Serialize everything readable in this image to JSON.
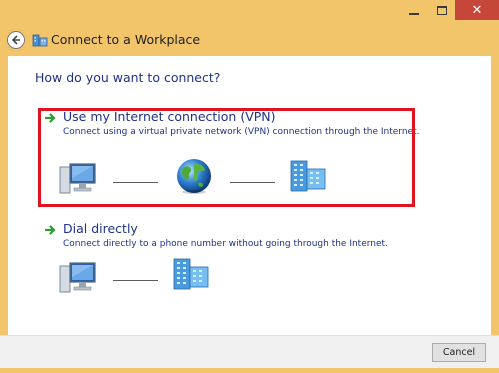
{
  "window": {
    "minimize_label": "",
    "close_symbol": "✕"
  },
  "header": {
    "title": "Connect to a Workplace",
    "back_icon": "back-arrow-icon",
    "app_icon": "workplace-network-icon"
  },
  "main": {
    "question": "How do you want to connect?",
    "options": [
      {
        "title": "Use my Internet connection (VPN)",
        "description": "Connect using a virtual private network (VPN) connection through the Internet.",
        "icons": [
          "computer-icon",
          "globe-icon",
          "server-icon"
        ],
        "highlighted": true
      },
      {
        "title": "Dial directly",
        "description": "Connect directly to a phone number without going through the Internet.",
        "icons": [
          "computer-icon",
          "server-icon"
        ],
        "highlighted": false
      }
    ]
  },
  "footer": {
    "cancel_label": "Cancel"
  },
  "colors": {
    "frame": "#f3c56a",
    "link_text": "#1e3287",
    "close_button": "#c7463a",
    "highlight_border": "#e0141e",
    "arrow_green": "#2ca02c"
  }
}
